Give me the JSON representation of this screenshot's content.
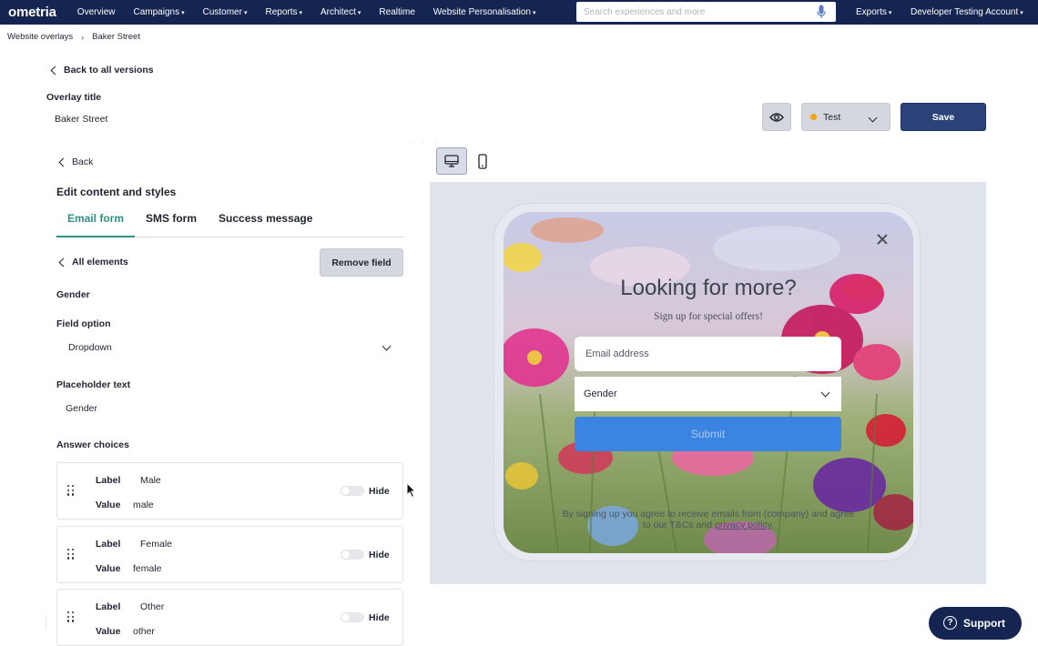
{
  "topnav": {
    "logo": "ometria",
    "items": [
      {
        "label": "Overview",
        "has_caret": false
      },
      {
        "label": "Campaigns",
        "has_caret": true
      },
      {
        "label": "Customer",
        "has_caret": true
      },
      {
        "label": "Reports",
        "has_caret": true
      },
      {
        "label": "Architect",
        "has_caret": true
      },
      {
        "label": "Realtime",
        "has_caret": false
      },
      {
        "label": "Website Personalisation",
        "has_caret": true
      }
    ],
    "search_placeholder": "Search experiences and more",
    "exports": "Exports",
    "account": "Developer Testing Account",
    "caret": "▾",
    "brand_color": "#152551"
  },
  "breadcrumb": {
    "items": [
      "Website overlays",
      "Baker Street"
    ],
    "separator": "›"
  },
  "header": {
    "back_all": "Back to all versions",
    "overlay_title_label": "Overlay title",
    "overlay_title_value": "Baker Street"
  },
  "editor": {
    "back": "Back",
    "title": "Edit content and styles",
    "tabs": [
      {
        "label": "Email form",
        "active": true
      },
      {
        "label": "SMS form",
        "active": false
      },
      {
        "label": "Success message",
        "active": false
      }
    ],
    "all_elements": "All elements",
    "remove_field": "Remove field",
    "field_name": "Gender",
    "field_option_label": "Field option",
    "field_option_value": "Dropdown",
    "placeholder_label": "Placeholder text",
    "placeholder_value": "Gender",
    "answers_label": "Answer choices",
    "choices": [
      {
        "label_key": "Label",
        "label": "Male",
        "value_key": "Value",
        "value": "male",
        "hide": "Hide",
        "hidden": false
      },
      {
        "label_key": "Label",
        "label": "Female",
        "value_key": "Value",
        "value": "female",
        "hide": "Hide",
        "hidden": false
      },
      {
        "label_key": "Label",
        "label": "Other",
        "value_key": "Value",
        "value": "other",
        "hide": "Hide",
        "hidden": false
      }
    ]
  },
  "controls": {
    "status": "Test",
    "status_color": "#f3a31b",
    "save": "Save",
    "save_color": "#2b4379",
    "preview_icon": "eye-icon",
    "desktop_icon": "desktop-icon",
    "mobile_icon": "mobile-icon"
  },
  "popup": {
    "headline": "Looking for more?",
    "subheadline": "Sign up for special offers!",
    "email_placeholder": "Email address",
    "gender": "Gender",
    "submit": "Submit",
    "submit_color": "#3c84e2",
    "terms_prefix": "By signing up you agree to receive emails from (company) and agree to our T&Cs and",
    "terms_link": "privacy policy",
    "terms_suffix": "."
  },
  "support": {
    "label": "Support",
    "icon": "?"
  }
}
